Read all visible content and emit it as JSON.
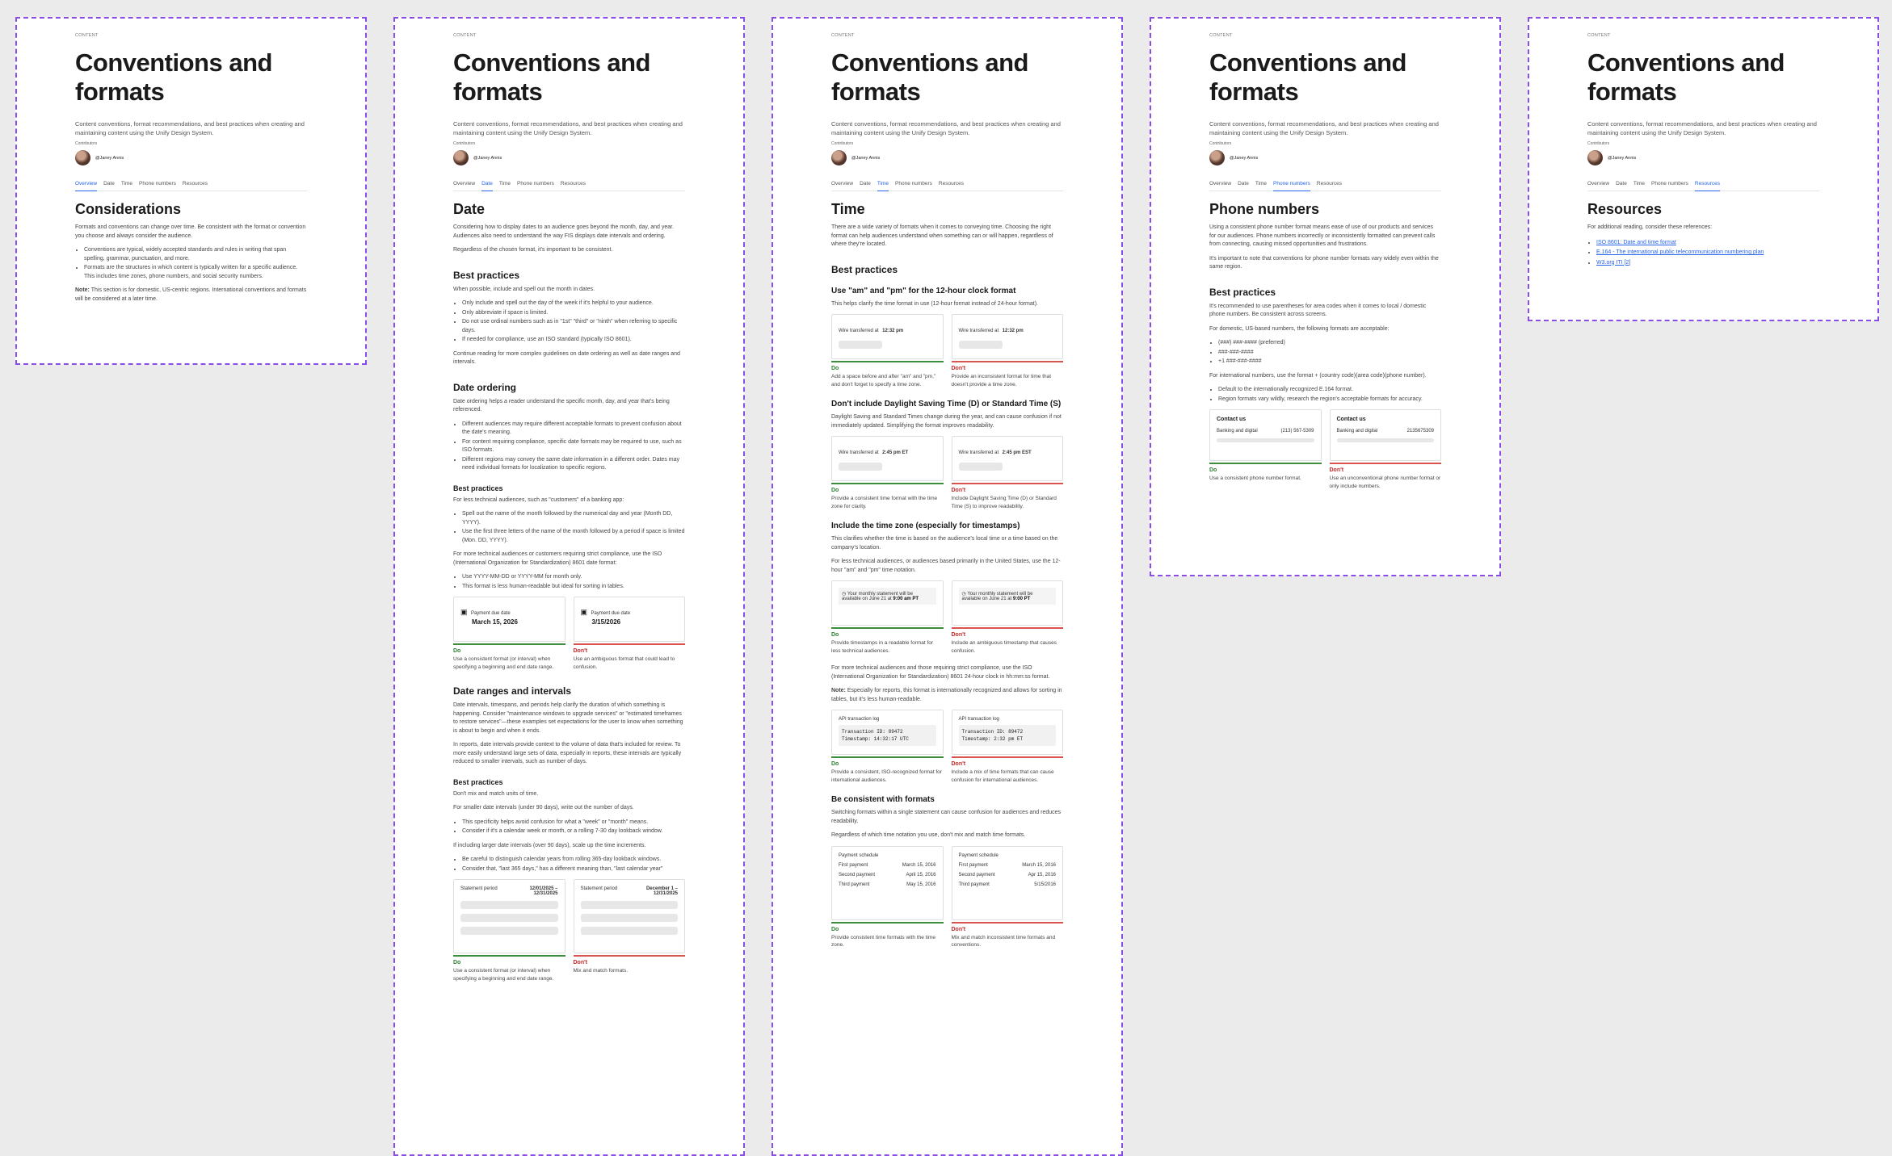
{
  "common": {
    "eyebrow": "Content",
    "title": "Conventions and formats",
    "lead": "Content conventions, format recommendations, and best practices when creating and maintaining content using the Unify Design System.",
    "contributors_label": "Contributors",
    "handle": "@Janey Annis",
    "tabs": [
      "Overview",
      "Date",
      "Time",
      "Phone numbers",
      "Resources"
    ]
  },
  "frame1": {
    "heading": "Considerations",
    "p1": "Formats and conventions can change over time. Be consistent with the format or convention you choose and always consider the audience.",
    "b1": "Conventions are typical, widely accepted standards and rules in writing that span spelling, grammar, punctuation, and more.",
    "b2": "Formats are the structures in which content is typically written for a specific audience. This includes time zones, phone numbers, and social security numbers.",
    "note_label": "Note:",
    "note": "This section is for domestic, US-centric regions. International conventions and formats will be considered at a later time."
  },
  "frame2": {
    "heading": "Date",
    "p1": "Considering how to display dates to an audience goes beyond the month, day, and year. Audiences also need to understand the way FIS displays date intervals and ordering.",
    "p2": "Regardless of the chosen format, it's important to be consistent.",
    "bp": "Best practices",
    "bp_intro": "When possible, include and spell out the month in dates.",
    "bp_items": [
      "Only include and spell out the day of the week if it's helpful to your audience.",
      "Only abbreviate if space is limited.",
      "Do not use ordinal numbers such as in \"1st\" \"third\" or \"ninth\" when referring to specific days.",
      "If needed for compliance, use an ISO standard (typically ISO 8601)."
    ],
    "continue": "Continue reading for more complex guidelines on date ordering as well as date ranges and intervals.",
    "ordering": "Date ordering",
    "ordering_p": "Date ordering helps a reader understand the specific month, day, and year that's being referenced.",
    "ordering_items": [
      "Different audiences may require different acceptable formats to prevent confusion about the date's meaning.",
      "For content requiring compliance, specific date formats may be required to use, such as ISO formats.",
      "Different regions may convey the same date information in a different order. Dates may need individual formats for localization to specific regions."
    ],
    "bp2": "Best practices",
    "less_tech": "For less technical audiences, such as \"customers\" of a banking app:",
    "less_tech_items": [
      "Spell out the name of the month followed by the numerical day and year (Month DD, YYYY).",
      "Use the first three letters of the name of the month followed by a period if space is limited (Mon. DD, YYYY)."
    ],
    "more_tech": "For more technical audiences or customers requiring strict compliance, use the ISO (International Organization for Standardization) 8601 date format:",
    "more_tech_items": [
      "Use YYYY-MM-DD or YYYY-MM for month only.",
      "This format is less human-readable but ideal for sorting in tables."
    ],
    "card_label": "Payment due date",
    "do_value": "March 15, 2026",
    "dont_value": "3/15/2026",
    "do": "Do",
    "dont": "Don't",
    "do_cap": "Use a consistent format (or interval) when specifying a beginning and end date range.",
    "dont_cap": "Use an ambiguous format that could lead to confusion.",
    "ranges": "Date ranges and intervals",
    "ranges_p1": "Date intervals, timespans, and periods help clarify the duration of which something is happening. Consider \"maintenance windows to upgrade services\" or \"estimated timeframes to restore services\"—these examples set expectations for the user to know when something is about to begin and when it ends.",
    "ranges_p2": "In reports, date intervals provide context to the volume of data that's included for review. To more easily understand large sets of data, especially in reports, these intervals are typically reduced to smaller intervals, such as number of days.",
    "bp3": "Best practices",
    "bp3_intro": "Don't mix and match units of time.",
    "small_intervals": "For smaller date intervals (under 90 days), write out the number of days.",
    "small_items": [
      "This specificity helps avoid confusion for what a \"week\" or \"month\" means.",
      "Consider if it's a calendar week or month, or a rolling 7-30 day lookback window."
    ],
    "large_intervals": "If including larger date intervals (over 90 days), scale up the time increments.",
    "large_items": [
      "Be careful to distinguish calendar years from rolling 365-day lookback windows.",
      "Consider that, \"last 365 days,\" has a different meaning than, \"last calendar year\""
    ],
    "stmt_label": "Statement period",
    "stmt_do": "12/01/2025 – 12/31/2025",
    "stmt_dont": "December 1 – 12/31/2025",
    "do_cap2": "Use a consistent format (or interval) when specifying a beginning and end date range.",
    "dont_cap2": "Mix and match formats."
  },
  "frame3": {
    "heading": "Time",
    "p1": "There are a wide variety of formats when it comes to conveying time. Choosing the right format can help audiences understand when something can or will happen, regardless of where they're located.",
    "bp": "Best practices",
    "s1": "Use \"am\" and \"pm\" for the 12-hour clock format",
    "s1_p": "This helps clarify the time format in use (12-hour format instead of 24-hour format).",
    "s1_do_text": "Wire transferred at",
    "s1_do_val": "12:32 pm",
    "s1_dont_val": "12:32 pm",
    "do": "Do",
    "dont": "Don't",
    "s1_do_cap": "Add a space before and after \"am\" and \"pm,\" and don't forget to specify a time zone.",
    "s1_dont_cap": "Provide an inconsistent format for time that doesn't provide a time zone.",
    "s2": "Don't include Daylight Saving Time (D) or Standard Time (S)",
    "s2_p": "Daylight Saving and Standard Times change during the year, and can cause confusion if not immediately updated. Simplifying the format improves readability.",
    "s2_do_val": "2:45 pm ET",
    "s2_dont_val": "2:45 pm EST",
    "s2_do_cap": "Provide a consistent time format with the time zone for clarity.",
    "s2_dont_cap": "Include Daylight Saving Time (D) or Standard Time (S) to improve readability.",
    "s3": "Include the time zone (especially for timestamps)",
    "s3_p1": "This clarifies whether the time is based on the audience's local time or a time based on the company's location.",
    "s3_p2": "For less technical audiences, or audiences based primarily in the United States, use the 12-hour \"am\" and \"pm\" time notation.",
    "s3_do_text": "Your monthly statement will be available on June 21 at",
    "s3_do_val": "9:00 am PT",
    "s3_dont_val": "9:00 PT",
    "s3_do_cap": "Provide timestamps in a readable format for less technical audiences.",
    "s3_dont_cap": "Include an ambiguous timestamp that causes confusion.",
    "s3_p3": "For more technical audiences and those requiring strict compliance, use the ISO (International Organization for Standardization) 8601 24-hour clock in hh:mm:ss format.",
    "note_label": "Note:",
    "s3_note": "Especially for reports, this format is internationally recognized and allows for sorting in tables, but it's less human-readable.",
    "log_label": "API transaction log",
    "log_l1": "Transaction ID: 89472",
    "log_do": "Timestamp: 14:32:17 UTC",
    "log_dont": "Timestamp: 2:32 pm ET",
    "s3_do_cap2": "Provide a consistent, ISO-recognized format for international audiences.",
    "s3_dont_cap2": "Include a mix of time formats that can cause confusion for international audiences.",
    "s4": "Be consistent with formats",
    "s4_p1": "Switching formats within a single statement can cause confusion for audiences and reduces readability.",
    "s4_p2": "Regardless of which time notation you use, don't mix and match time formats.",
    "sched_label": "Payment schedule",
    "sched_rows": [
      "First payment",
      "Second payment",
      "Third payment"
    ],
    "sched_do": [
      "March 15, 2016",
      "April 15, 2016",
      "May 15, 2016"
    ],
    "sched_dont": [
      "March 15, 2016",
      "Apr 15, 2016",
      "5/15/2016"
    ],
    "s4_do_cap": "Provide consistent time formats with the time zone.",
    "s4_dont_cap": "Mix and match inconsistent time formats and conventions."
  },
  "frame4": {
    "heading": "Phone numbers",
    "p1": "Using a consistent phone number format means ease of use of our products and services for our audiences. Phone numbers incorrectly or inconsistently formatted can prevent calls from connecting, causing missed opportunities and frustrations.",
    "p2": "It's important to note that conventions for phone number formats vary widely even within the same region.",
    "bp": "Best practices",
    "bp_p1": "It's recommended to use parentheses for area codes when it comes to local / domestic phone numbers. Be consistent across screens.",
    "bp_p2": "For domestic, US-based numbers, the following formats are acceptable:",
    "formats": [
      "(###) ###-#### (preferred)",
      "###-###-####",
      "+1 ###-###-####"
    ],
    "intl": "For international numbers, use the format + (country code)(area code)(phone number).",
    "intl_items": [
      "Default to the internationally recognized E.164 format.",
      "Region formats vary wildly, research the region's acceptable formats for accuracy."
    ],
    "card_title": "Contact us",
    "card_sub": "Banking and digital",
    "do_phone": "(213) 567-5309",
    "dont_phone": "2135675309",
    "do": "Do",
    "dont": "Don't",
    "do_cap": "Use a consistent phone number format.",
    "dont_cap": "Use an unconventional phone number format or only include numbers."
  },
  "frame5": {
    "heading": "Resources",
    "p1": "For additional reading, consider these references:",
    "links": [
      "ISO 8601: Date and time format",
      "E.164 - The international public telecommunication numbering plan",
      "W3.org ITI [2]"
    ]
  }
}
